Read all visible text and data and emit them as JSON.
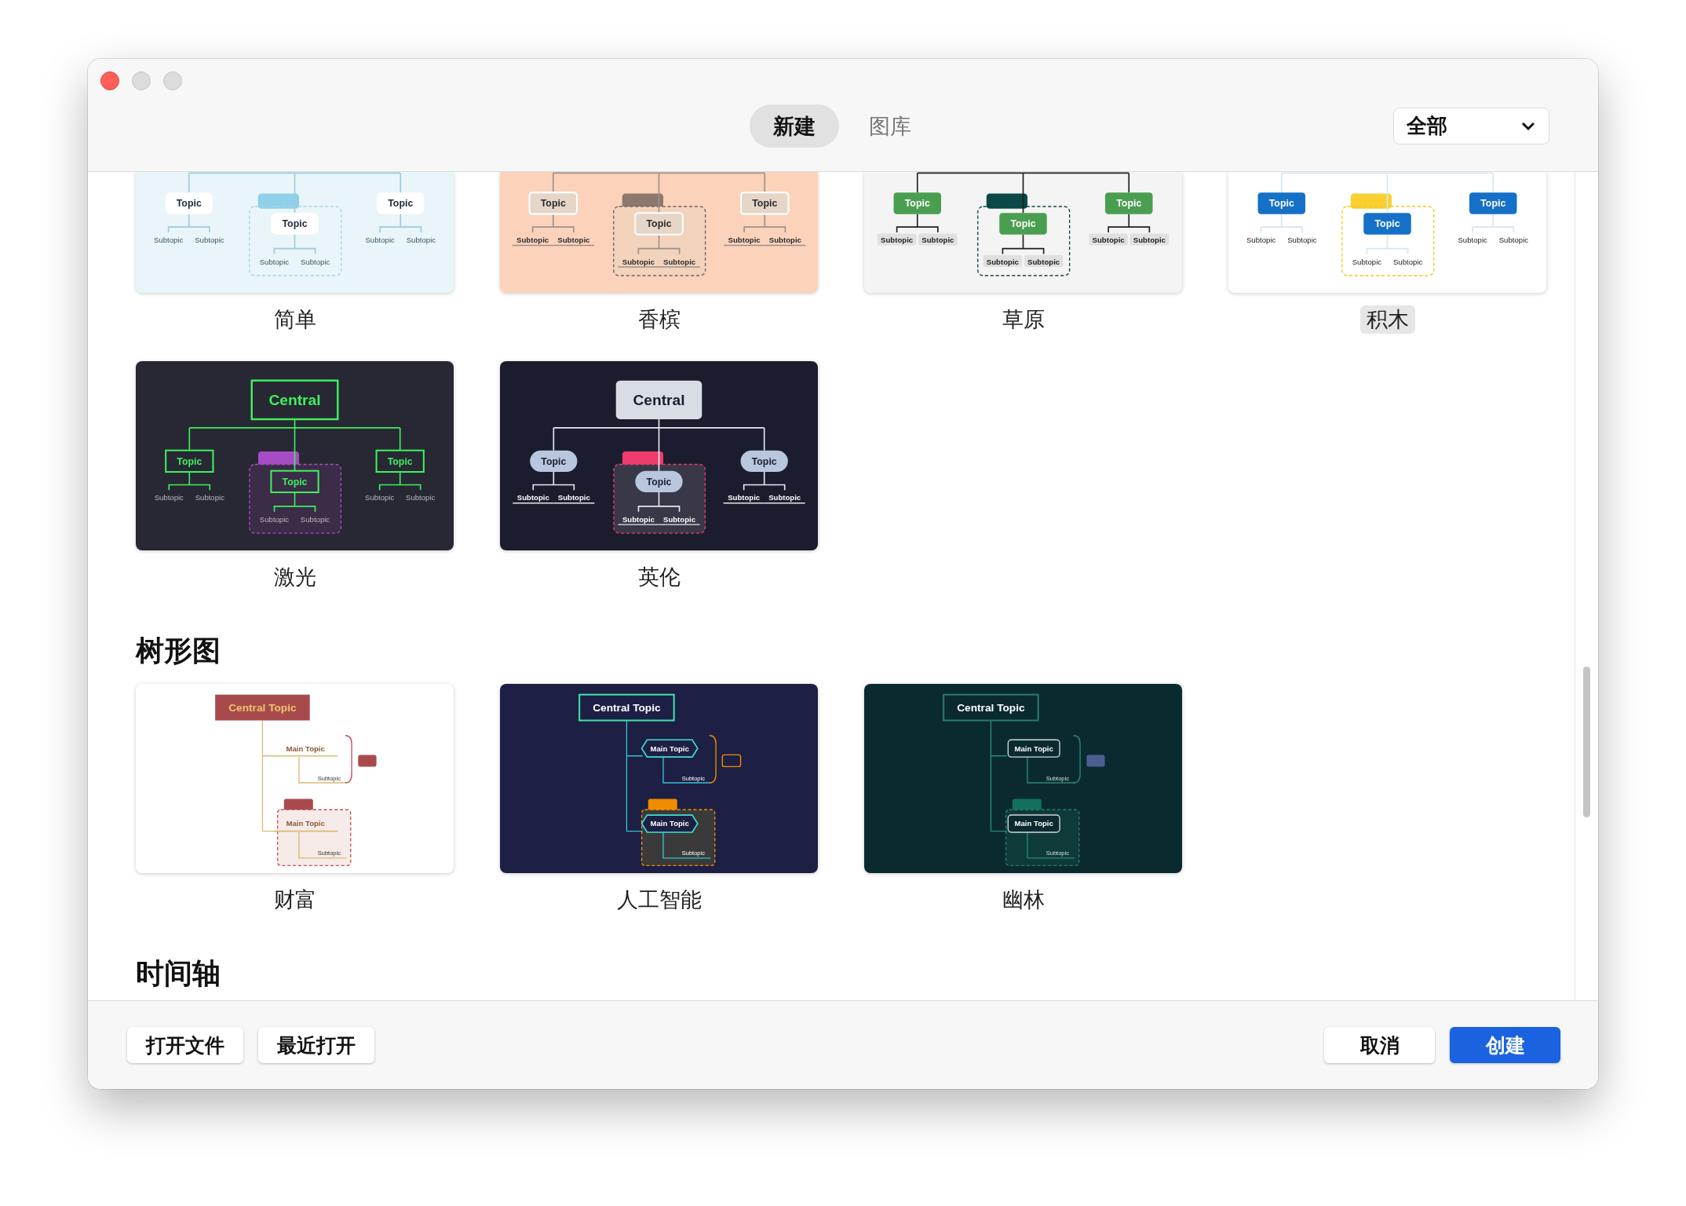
{
  "traffic_lights": [
    {
      "kind": "close"
    },
    {
      "kind": "minimize"
    },
    {
      "kind": "zoom"
    }
  ],
  "tabs": [
    {
      "label": "新建",
      "selected": true
    },
    {
      "label": "图库",
      "selected": false
    }
  ],
  "filter": {
    "value": "全部"
  },
  "sections": [
    {
      "templates": [
        {
          "name": "简单",
          "selected": false,
          "kind": "simple",
          "topics": [
            {
              "label": "Topic",
              "subtopics": [
                "Subtopic",
                "Subtopic"
              ]
            },
            {
              "label": "Topic",
              "subtopics": [
                "Subtopic",
                "Subtopic"
              ]
            },
            {
              "label": "Topic",
              "subtopics": [
                "Subtopic",
                "Subtopic"
              ]
            }
          ]
        },
        {
          "name": "香槟",
          "selected": false,
          "kind": "champagne",
          "topics": [
            {
              "label": "Topic",
              "subtopics": [
                "Subtopic",
                "Subtopic"
              ]
            },
            {
              "label": "Topic",
              "subtopics": [
                "Subtopic",
                "Subtopic"
              ]
            },
            {
              "label": "Topic",
              "subtopics": [
                "Subtopic",
                "Subtopic"
              ]
            }
          ]
        },
        {
          "name": "草原",
          "selected": false,
          "kind": "grass",
          "topics": [
            {
              "label": "Topic",
              "subtopics": [
                "Subtopic",
                "Subtopic"
              ]
            },
            {
              "label": "Topic",
              "subtopics": [
                "Subtopic",
                "Subtopic"
              ]
            },
            {
              "label": "Topic",
              "subtopics": [
                "Subtopic",
                "Subtopic"
              ]
            }
          ]
        },
        {
          "name": "积木",
          "selected": true,
          "kind": "blocks",
          "topics": [
            {
              "label": "Topic",
              "subtopics": [
                "Subtopic",
                "Subtopic"
              ]
            },
            {
              "label": "Topic",
              "subtopics": [
                "Subtopic",
                "Subtopic"
              ]
            },
            {
              "label": "Topic",
              "subtopics": [
                "Subtopic",
                "Subtopic"
              ]
            }
          ]
        },
        {
          "name": "激光",
          "selected": false,
          "kind": "laser",
          "central": "Central",
          "topics": [
            {
              "label": "Topic",
              "subtopics": [
                "Subtopic",
                "Subtopic"
              ]
            },
            {
              "label": "Topic",
              "subtopics": [
                "Subtopic",
                "Subtopic"
              ]
            },
            {
              "label": "Topic",
              "subtopics": [
                "Subtopic",
                "Subtopic"
              ]
            }
          ]
        },
        {
          "name": "英伦",
          "selected": false,
          "kind": "england",
          "central": "Central",
          "topics": [
            {
              "label": "Topic",
              "subtopics": [
                "Subtopic",
                "Subtopic"
              ]
            },
            {
              "label": "Topic",
              "subtopics": [
                "Subtopic",
                "Subtopic"
              ]
            },
            {
              "label": "Topic",
              "subtopics": [
                "Subtopic",
                "Subtopic"
              ]
            }
          ]
        }
      ]
    },
    {
      "title": "树形图",
      "templates": [
        {
          "name": "财富",
          "selected": false,
          "kind": "wealth",
          "central": "Central Topic",
          "topics": [
            {
              "label": "Main Topic",
              "subtopics": [
                "Subtopic"
              ]
            },
            {
              "label": "Main Topic",
              "subtopics": [
                "Subtopic"
              ]
            }
          ]
        },
        {
          "name": "人工智能",
          "selected": false,
          "kind": "ai",
          "central": "Central Topic",
          "topics": [
            {
              "label": "Main Topic",
              "subtopics": [
                "Subtopic"
              ]
            },
            {
              "label": "Main Topic",
              "subtopics": [
                "Subtopic"
              ]
            }
          ]
        },
        {
          "name": "幽林",
          "selected": false,
          "kind": "forest",
          "central": "Central Topic",
          "topics": [
            {
              "label": "Main Topic",
              "subtopics": [
                "Subtopic"
              ]
            },
            {
              "label": "Main Topic",
              "subtopics": [
                "Subtopic"
              ]
            }
          ]
        }
      ]
    },
    {
      "title": "时间轴"
    }
  ],
  "footer_left_buttons": [
    {
      "label": "打开文件"
    },
    {
      "label": "最近打开"
    }
  ],
  "footer_right_buttons": [
    {
      "label": "取消",
      "kind": "default"
    },
    {
      "label": "创建",
      "kind": "primary"
    }
  ]
}
